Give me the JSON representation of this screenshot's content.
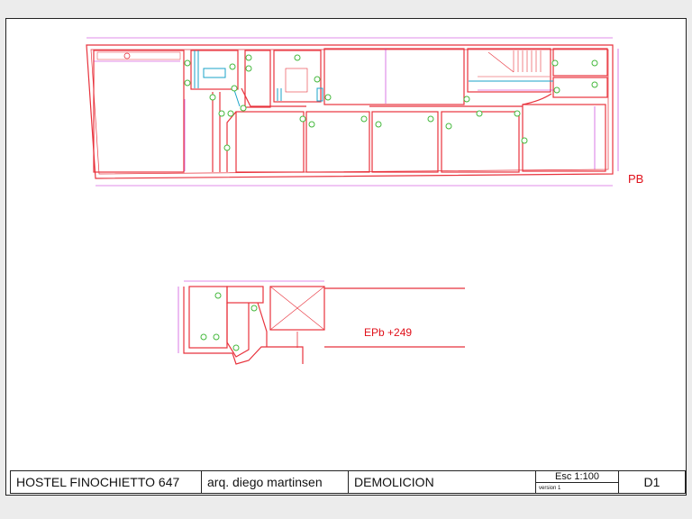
{
  "plans": {
    "ground_floor_label": "PB",
    "mezzanine_label": "EPb +249"
  },
  "title_block": {
    "project": "HOSTEL FINOCHIETTO 647",
    "architect": "arq. diego martinsen",
    "sheet_type": "DEMOLICION",
    "scale": "Esc 1:100",
    "version": "version 1",
    "sheet_number": "D1"
  },
  "colors": {
    "wall": "#e8323c",
    "dimension": "#c21fd6",
    "fixture": "#1aa3c8",
    "marker": "#44b83c",
    "label": "#e0101a"
  }
}
